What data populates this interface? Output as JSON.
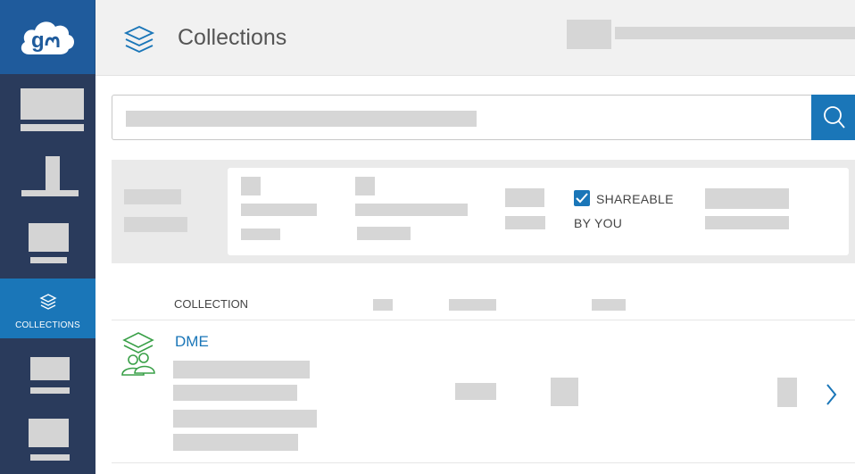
{
  "app": {
    "logo_icon": "globus-cloud-logo",
    "accent_color": "#1a76b8",
    "sidebar_color": "#2a3b5c"
  },
  "sidebar": {
    "active_item": {
      "label": "COLLECTIONS",
      "icon": "layers-icon"
    }
  },
  "header": {
    "title": "Collections",
    "icon": "layers-icon"
  },
  "search": {
    "icon": "search-icon"
  },
  "filters": {
    "shareable": {
      "checked": true,
      "label_line1": "SHAREABLE",
      "label_line2": "BY YOU"
    }
  },
  "table": {
    "column_header": "COLLECTION",
    "rows": [
      {
        "name": "DME",
        "icon": "shared-collection-icon",
        "action_icon": "chevron-right-icon"
      }
    ]
  }
}
